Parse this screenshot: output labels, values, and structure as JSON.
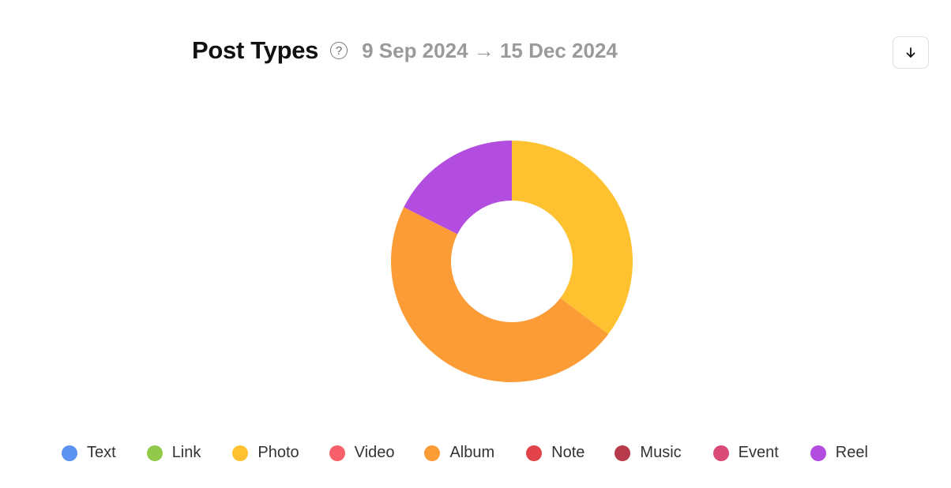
{
  "header": {
    "title": "Post Types",
    "help_icon": "question-circle-icon",
    "date_range": "9 Sep 2024 → 15 Dec 2024"
  },
  "toolbar": {
    "download_icon": "arrow-down-icon",
    "download_glyph": "↓"
  },
  "chart_data": {
    "type": "pie",
    "variant": "donut",
    "title": "Post Types",
    "subtitle": "9 Sep 2024 → 15 Dec 2024",
    "start_angle": "top, clockwise",
    "legend_position": "bottom",
    "categories": [
      "Text",
      "Link",
      "Photo",
      "Video",
      "Album",
      "Note",
      "Music",
      "Event",
      "Reel"
    ],
    "colors": [
      "#5b93f0",
      "#93c94a",
      "#fec12f",
      "#f7606a",
      "#fc9c37",
      "#e2434a",
      "#b83b4b",
      "#d94a77",
      "#b34ddf"
    ],
    "values": [
      0,
      0,
      35.3,
      0,
      47.1,
      0,
      0,
      0,
      17.6
    ],
    "value_unit": "percent (estimated)"
  }
}
